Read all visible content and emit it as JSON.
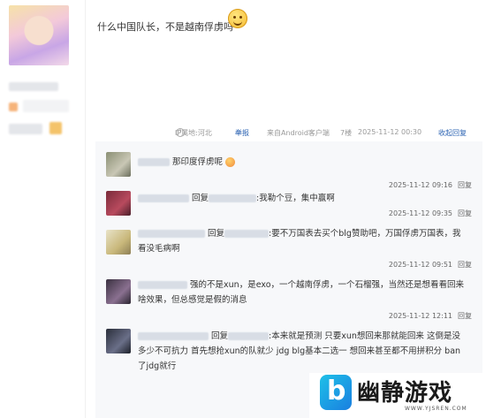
{
  "post": {
    "text": "什么中国队长，不是越南俘虏吗",
    "meta": {
      "ip": "IP属地:河北",
      "report": "举报",
      "client": "来自Android客户端",
      "floor": "7楼",
      "time": "2025-11-12 00:30",
      "collapse": "收起回复"
    }
  },
  "replies": [
    {
      "prefix": "",
      "text": "那印度俘虏呢",
      "time": "2025-11-12 09:16",
      "reply_label": "回复"
    },
    {
      "prefix": "回复",
      "text": ":我勒个豆，集中赢啊",
      "time": "2025-11-12 09:35",
      "reply_label": "回复"
    },
    {
      "prefix": "回复",
      "text": ":要不万国表去买个blg赞助吧，万国俘虏万国表，我看没毛病啊",
      "time": "2025-11-12 09:51",
      "reply_label": "回复"
    },
    {
      "prefix": "",
      "text": "强的不是xun，是exo，一个越南俘虏，一个石榴强，当然还是想看看回来啥效果，但总感觉是假的消息",
      "time": "2025-11-12 12:11",
      "reply_label": "回复"
    },
    {
      "prefix": "回复",
      "text": ":本来就是预测 只要xun想回来那就能回来 这倒是没多少不可抗力 首先想抢xun的队就少 jdg blg基本二选一 想回来甚至都不用拼积分 ban了jdg就行",
      "time": "",
      "reply_label": ""
    }
  ],
  "watermark": {
    "title": "幽静游戏",
    "url": "WWW.YJSREN.COM"
  }
}
